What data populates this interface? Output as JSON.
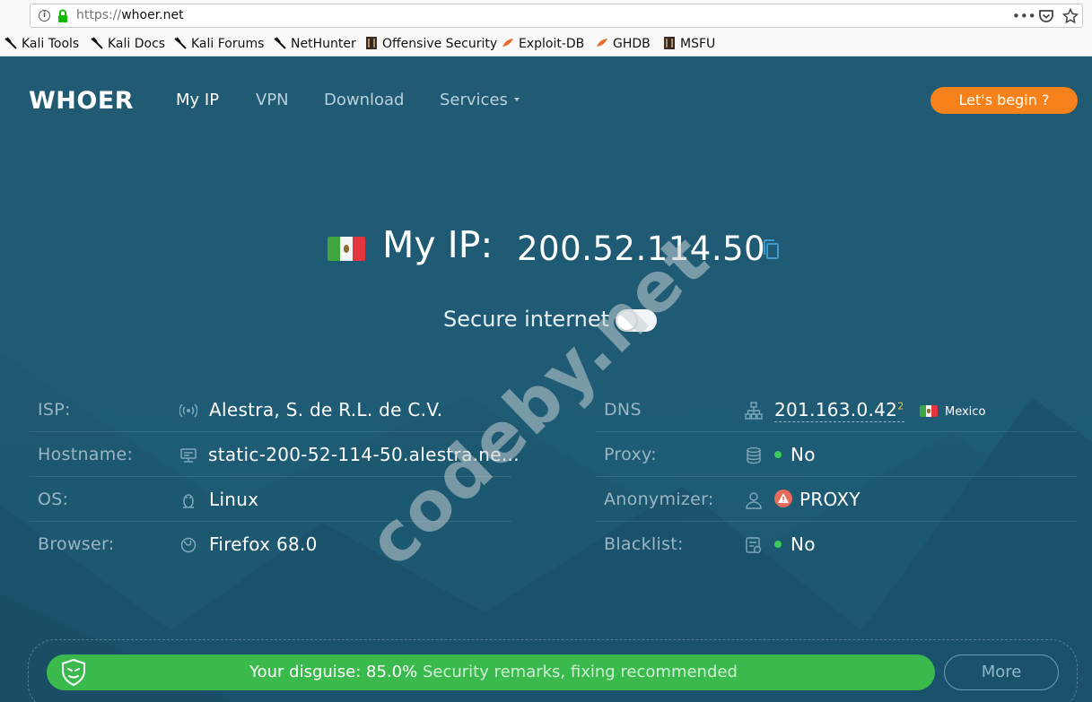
{
  "browser": {
    "url_prefix": "https://",
    "url_host": "whoer.net",
    "bookmarks": [
      {
        "label": "Kali Tools",
        "icon": "kali-dragon-icon"
      },
      {
        "label": "Kali Docs",
        "icon": "kali-dragon-icon"
      },
      {
        "label": "Kali Forums",
        "icon": "kali-dragon-icon"
      },
      {
        "label": "NetHunter",
        "icon": "kali-dragon-icon"
      },
      {
        "label": "Offensive Security",
        "icon": "offsec-icon"
      },
      {
        "label": "Exploit-DB",
        "icon": "exploitdb-icon"
      },
      {
        "label": "GHDB",
        "icon": "exploitdb-icon"
      },
      {
        "label": "MSFU",
        "icon": "offsec-icon"
      }
    ]
  },
  "site": {
    "logo": "WHOER",
    "nav": [
      "My IP",
      "VPN",
      "Download",
      "Services"
    ],
    "cta": "Let's begin ?"
  },
  "hero": {
    "label": "My IP:",
    "ip": "200.52.114.50",
    "country_flag": "mexico-flag-icon",
    "secure_label": "Secure internet",
    "secure_enabled": false
  },
  "left_rows": [
    {
      "label": "ISP:",
      "value": "Alestra, S. de R.L. de C.V.",
      "icon": "signal-icon"
    },
    {
      "label": "Hostname:",
      "value": "static-200-52-114-50.alestra.ne...",
      "icon": "server-icon"
    },
    {
      "label": "OS:",
      "value": "Linux",
      "icon": "linux-icon"
    },
    {
      "label": "Browser:",
      "value": "Firefox 68.0",
      "icon": "firefox-icon"
    }
  ],
  "right_rows": [
    {
      "label": "DNS",
      "value": "201.163.0.42",
      "sup": "2",
      "country": "Mexico",
      "icon": "network-icon"
    },
    {
      "label": "Proxy:",
      "value": "No",
      "status": "ok",
      "icon": "database-icon"
    },
    {
      "label": "Anonymizer:",
      "value": "PROXY",
      "status": "warning",
      "icon": "user-icon"
    },
    {
      "label": "Blacklist:",
      "value": "No",
      "status": "ok",
      "icon": "checklist-icon"
    }
  ],
  "watermark": "codeby.net",
  "footer": {
    "disguise_label": "Your disguise: 85.0%",
    "disguise_note": "Security remarks, fixing recommended",
    "disguise_percent": 85.0,
    "more": "More"
  },
  "colors": {
    "background": "#1f5b74",
    "accent_orange": "#f7821b",
    "success_green": "#3aba4d",
    "warning_red": "#e56b5b"
  }
}
